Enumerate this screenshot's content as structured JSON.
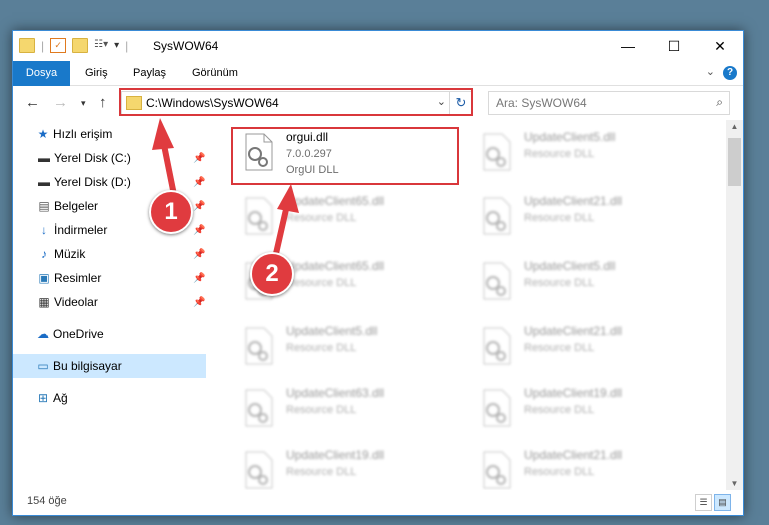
{
  "window": {
    "title": "SysWOW64",
    "min_symbol": "—",
    "max_symbol": "☐",
    "close_symbol": "✕"
  },
  "ribbon": {
    "file_tab": "Dosya",
    "tabs": [
      "Giriş",
      "Paylaş",
      "Görünüm"
    ],
    "help": "?"
  },
  "nav": {
    "address": "C:\\Windows\\SysWOW64",
    "search_placeholder": "Ara: SysWOW64"
  },
  "sidebar": {
    "items": [
      {
        "label": "Hızlı erişim",
        "icon": "star-icon"
      },
      {
        "label": "Yerel Disk (C:)",
        "icon": "drive-icon",
        "pinned": true
      },
      {
        "label": "Yerel Disk (D:)",
        "icon": "drive-icon",
        "pinned": true
      },
      {
        "label": "Belgeler",
        "icon": "documents-icon",
        "pinned": true
      },
      {
        "label": "İndirmeler",
        "icon": "download-icon",
        "pinned": true
      },
      {
        "label": "Müzik",
        "icon": "music-icon",
        "pinned": true
      },
      {
        "label": "Resimler",
        "icon": "pictures-icon",
        "pinned": true
      },
      {
        "label": "Videolar",
        "icon": "videos-icon",
        "pinned": true
      },
      {
        "label": "OneDrive",
        "icon": "cloud-icon"
      },
      {
        "label": "Bu bilgisayar",
        "icon": "computer-icon",
        "selected": true
      },
      {
        "label": "Ağ",
        "icon": "network-icon"
      }
    ]
  },
  "files": {
    "highlight": {
      "name": "orgui.dll",
      "version": "7.0.0.297",
      "description": "OrgUI DLL"
    },
    "left_column": [
      {
        "name": "UpdateClient65.dll",
        "type": "Resource DLL"
      },
      {
        "name": "UpdateClient65.dll",
        "type": "Resource DLL"
      },
      {
        "name": "UpdateClient5.dll",
        "type": "Resource DLL"
      },
      {
        "name": "UpdateClient63.dll",
        "type": "Resource DLL"
      },
      {
        "name": "UpdateClient19.dll",
        "type": "Resource DLL"
      }
    ],
    "right_column": [
      {
        "name": "UpdateClient5.dll",
        "type": "Resource DLL"
      },
      {
        "name": "UpdateClient21.dll",
        "type": "Resource DLL"
      },
      {
        "name": "UpdateClient5.dll",
        "type": "Resource DLL"
      },
      {
        "name": "UpdateClient21.dll",
        "type": "Resource DLL"
      },
      {
        "name": "UpdateClient19.dll",
        "type": "Resource DLL"
      },
      {
        "name": "UpdateClient21.dll",
        "type": "Resource DLL"
      }
    ]
  },
  "status": {
    "count": "154 öğe"
  },
  "annotations": {
    "marker1": "1",
    "marker2": "2",
    "color": "#e03b3f"
  }
}
